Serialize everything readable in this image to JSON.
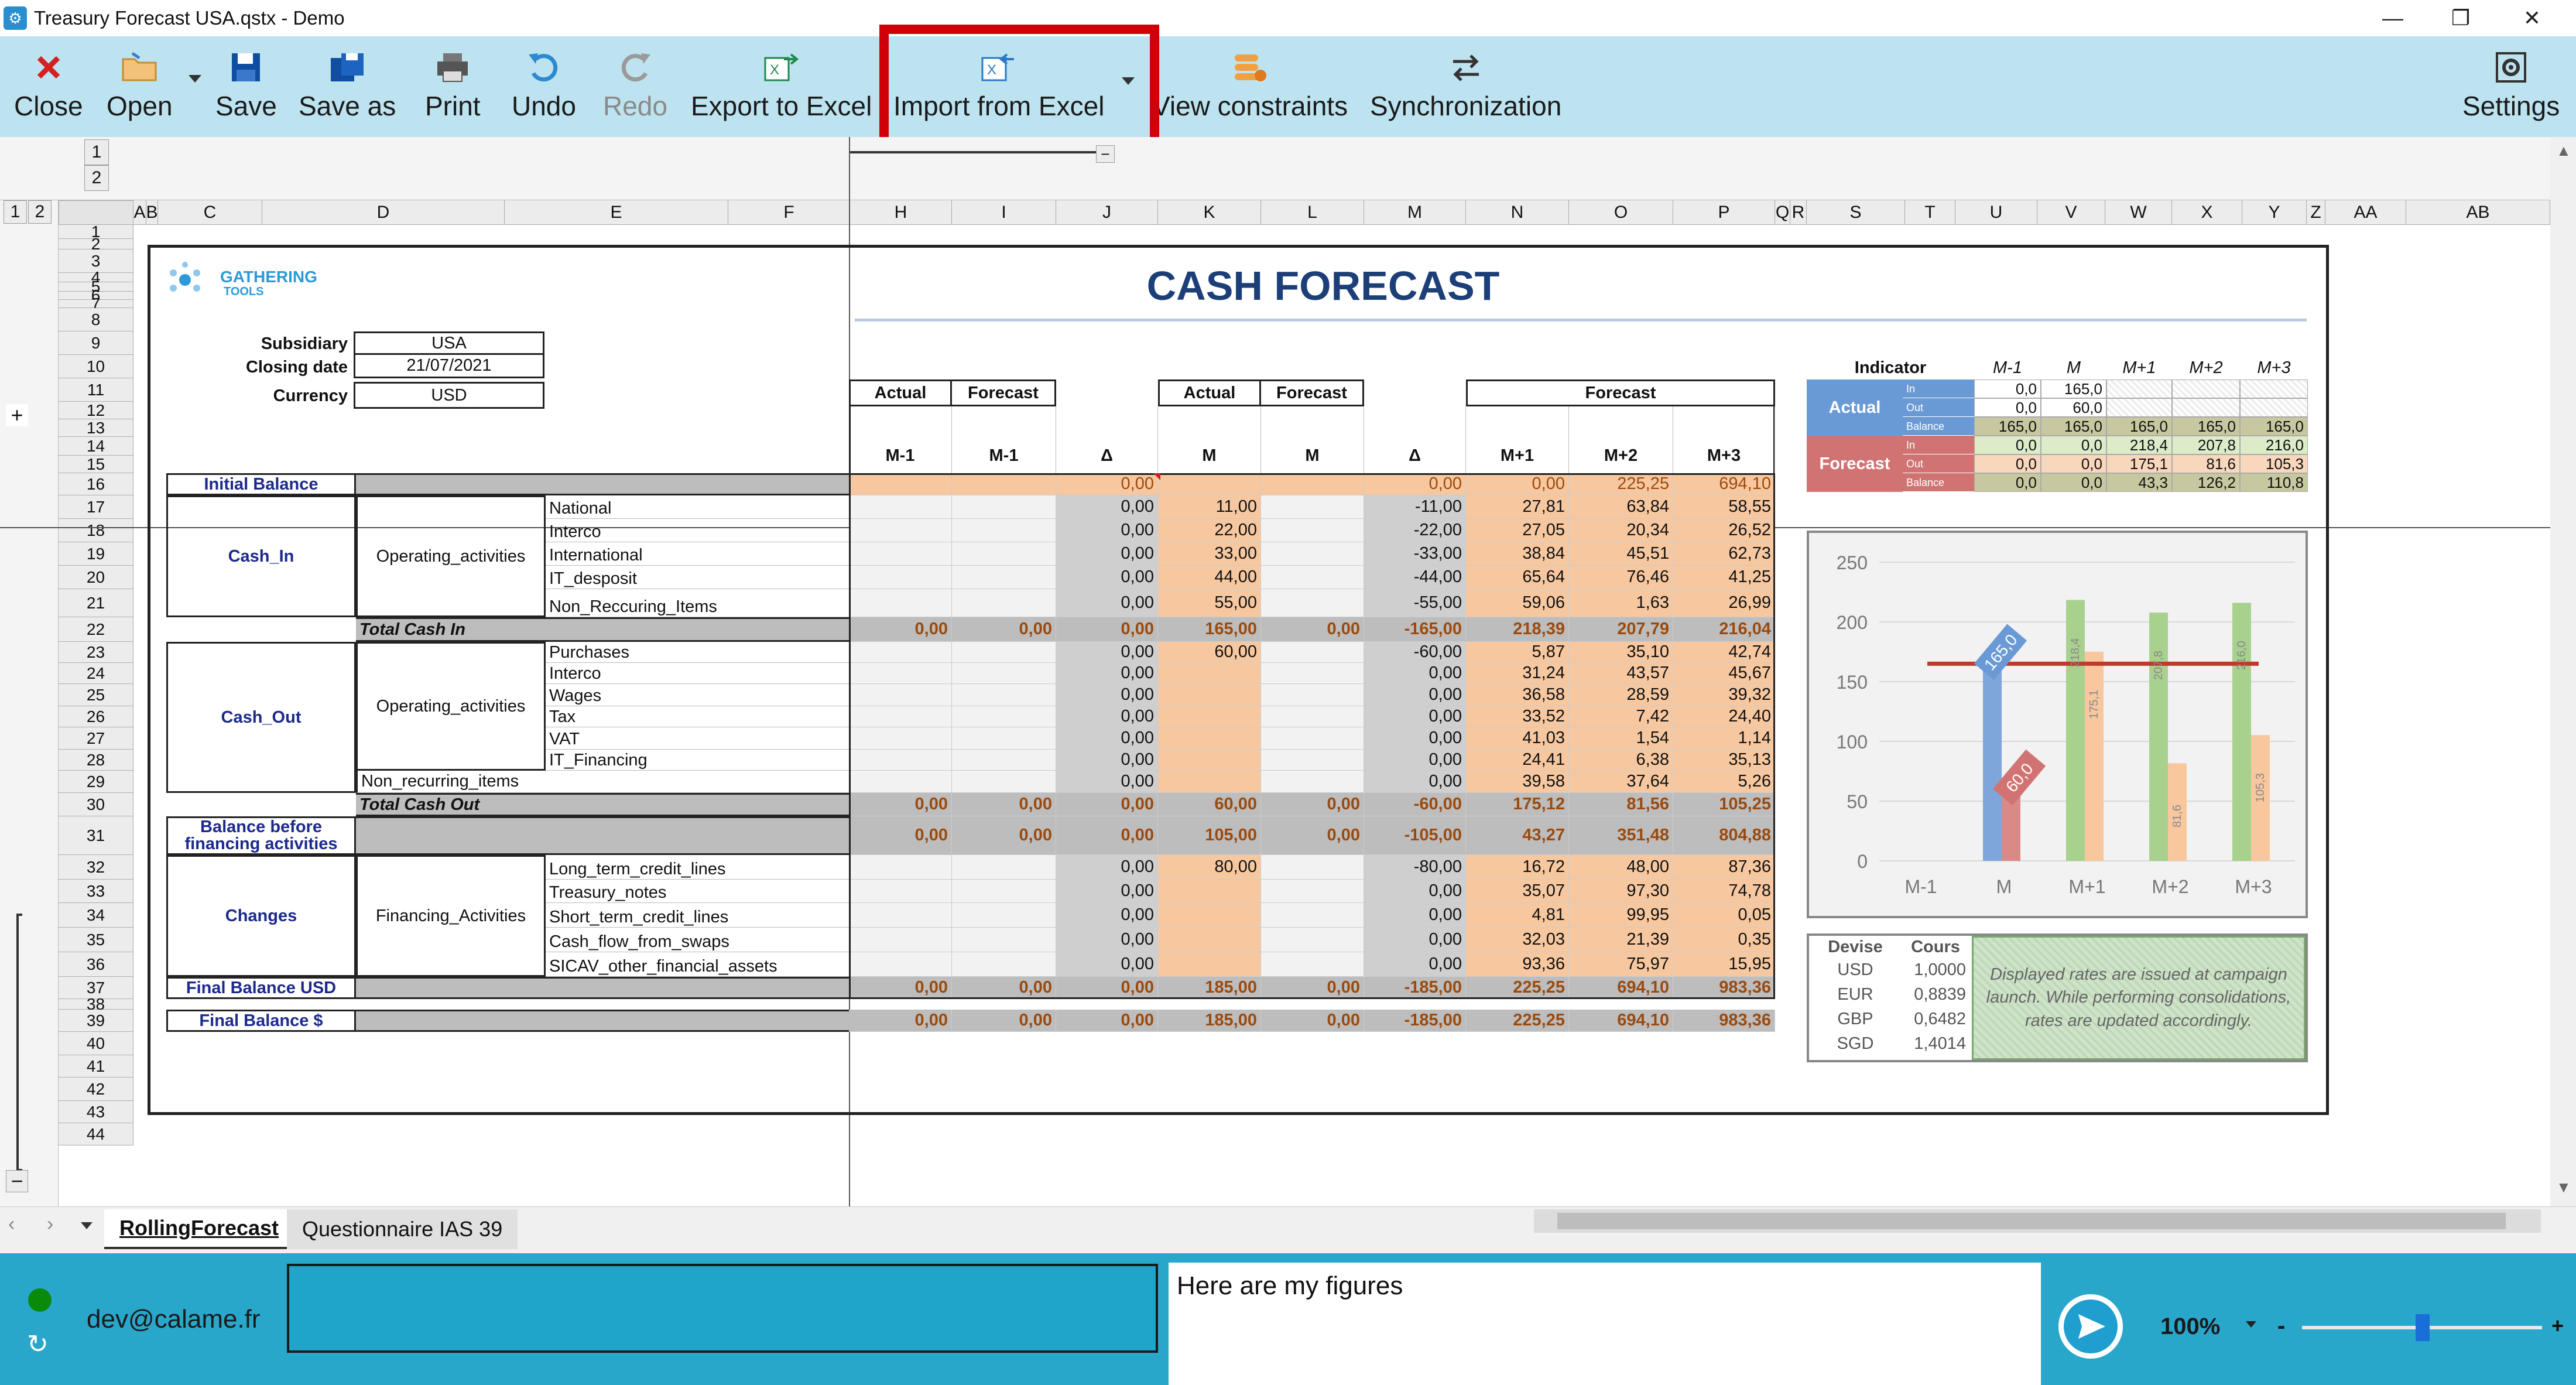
{
  "window": {
    "title": "Treasury Forecast USA.qstx - Demo",
    "min": "—",
    "max": "❐",
    "close": "✕"
  },
  "toolbar": {
    "close": "Close",
    "open": "Open",
    "save": "Save",
    "save_as": "Save as",
    "print": "Print",
    "undo": "Undo",
    "redo": "Redo",
    "export": "Export to Excel",
    "import": "Import from Excel",
    "constraints": "View constraints",
    "sync": "Synchronization",
    "settings": "Settings"
  },
  "grid": {
    "outline_levels": [
      "1",
      "2"
    ],
    "row_outline_levels": [
      "1",
      "2"
    ],
    "columns": [
      "A",
      "B",
      "C",
      "D",
      "E",
      "F",
      "H",
      "I",
      "J",
      "K",
      "L",
      "M",
      "N",
      "O",
      "P",
      "Q",
      "R",
      "S",
      "T",
      "U",
      "V",
      "W",
      "X",
      "Y",
      "Z",
      "AA",
      "AB"
    ],
    "rows": [
      "1",
      "2",
      "3",
      "4",
      "5",
      "6",
      "7",
      "8",
      "9",
      "10",
      "11",
      "12",
      "13",
      "14",
      "15",
      "16",
      "17",
      "18",
      "19",
      "20",
      "21",
      "22",
      "23",
      "24",
      "25",
      "26",
      "27",
      "28",
      "29",
      "30",
      "31",
      "32",
      "33",
      "34",
      "35",
      "36",
      "37",
      "38",
      "39",
      "40",
      "41",
      "42",
      "43",
      "44"
    ],
    "plus": "+",
    "minus": "−"
  },
  "sheet": {
    "logo_line1": "GATHERING",
    "logo_line2": "TOOLS",
    "title": "CASH FORECAST",
    "subsidiary_label": "Subsidiary",
    "subsidiary": "USA",
    "closing_label": "Closing date",
    "closing": "21/07/2021",
    "currency_label": "Currency",
    "currency": "USD",
    "hdr_actual": "Actual",
    "hdr_forecast": "Forecast",
    "hdr_forecast3": "Forecast",
    "col_m_1a": "M-1",
    "col_m_1f": "M-1",
    "col_d": "Δ",
    "col_ma": "M",
    "col_mf": "M",
    "col_d2": "Δ",
    "col_p1": "M+1",
    "col_p2": "M+2",
    "col_p3": "M+3",
    "initial_balance": "Initial Balance",
    "cash_in": "Cash_In",
    "operating": "Operating_activities",
    "cash_out": "Cash_Out",
    "operating2": "Operating_activities",
    "nonrec": "Non_recurring_items",
    "total_in": "Total Cash In",
    "total_out": "Total Cash Out",
    "balance_before": "Balance before financing activities",
    "changes": "Changes",
    "financing": "Financing_Activities",
    "final_usd": "Final Balance USD",
    "final_s": "Final Balance $",
    "rows": [
      {
        "label": "National",
        "v": [
          "",
          "",
          "0,00",
          "11,00",
          "",
          "-11,00",
          "27,81",
          "63,84",
          "58,55"
        ]
      },
      {
        "label": "Interco",
        "v": [
          "",
          "",
          "0,00",
          "22,00",
          "",
          "-22,00",
          "27,05",
          "20,34",
          "26,52"
        ]
      },
      {
        "label": "International",
        "v": [
          "",
          "",
          "0,00",
          "33,00",
          "",
          "-33,00",
          "38,84",
          "45,51",
          "62,73"
        ]
      },
      {
        "label": "IT_desposit",
        "v": [
          "",
          "",
          "0,00",
          "44,00",
          "",
          "-44,00",
          "65,64",
          "76,46",
          "41,25"
        ]
      },
      {
        "label": "Non_Reccuring_Items",
        "v": [
          "",
          "",
          "0,00",
          "55,00",
          "",
          "-55,00",
          "59,06",
          "1,63",
          "26,99"
        ]
      },
      {
        "label": "Purchases",
        "v": [
          "",
          "",
          "0,00",
          "60,00",
          "",
          "-60,00",
          "5,87",
          "35,10",
          "42,74"
        ]
      },
      {
        "label": "Interco",
        "v": [
          "",
          "",
          "0,00",
          "",
          "",
          "0,00",
          "31,24",
          "43,57",
          "45,67"
        ]
      },
      {
        "label": "Wages",
        "v": [
          "",
          "",
          "0,00",
          "",
          "",
          "0,00",
          "36,58",
          "28,59",
          "39,32"
        ]
      },
      {
        "label": "Tax",
        "v": [
          "",
          "",
          "0,00",
          "",
          "",
          "0,00",
          "33,52",
          "7,42",
          "24,40"
        ]
      },
      {
        "label": "VAT",
        "v": [
          "",
          "",
          "0,00",
          "",
          "",
          "0,00",
          "41,03",
          "1,54",
          "1,14"
        ]
      },
      {
        "label": "IT_Financing",
        "v": [
          "",
          "",
          "0,00",
          "",
          "",
          "0,00",
          "24,41",
          "6,38",
          "35,13"
        ]
      },
      {
        "label": "",
        "v": [
          "",
          "",
          "0,00",
          "",
          "",
          "0,00",
          "39,58",
          "37,64",
          "5,26"
        ]
      },
      {
        "label": "Long_term_credit_lines",
        "v": [
          "",
          "",
          "0,00",
          "80,00",
          "",
          "-80,00",
          "16,72",
          "48,00",
          "87,36"
        ]
      },
      {
        "label": "Treasury_notes",
        "v": [
          "",
          "",
          "0,00",
          "",
          "",
          "0,00",
          "35,07",
          "97,30",
          "74,78"
        ]
      },
      {
        "label": "Short_term_credit_lines",
        "v": [
          "",
          "",
          "0,00",
          "",
          "",
          "0,00",
          "4,81",
          "99,95",
          "0,05"
        ]
      },
      {
        "label": "Cash_flow_from_swaps",
        "v": [
          "",
          "",
          "0,00",
          "",
          "",
          "0,00",
          "32,03",
          "21,39",
          "0,35"
        ]
      },
      {
        "label": "SICAV_other_financial_assets",
        "v": [
          "",
          "",
          "0,00",
          "",
          "",
          "0,00",
          "93,36",
          "75,97",
          "15,95"
        ]
      }
    ],
    "initial_vals": [
      "",
      "",
      "0,00",
      "",
      "",
      "0,00",
      "0,00",
      "225,25",
      "694,10"
    ],
    "total_in_vals": [
      "0,00",
      "0,00",
      "0,00",
      "165,00",
      "0,00",
      "-165,00",
      "218,39",
      "207,79",
      "216,04"
    ],
    "total_out_vals": [
      "0,00",
      "0,00",
      "0,00",
      "60,00",
      "0,00",
      "-60,00",
      "175,12",
      "81,56",
      "105,25"
    ],
    "bbf_vals": [
      "0,00",
      "0,00",
      "0,00",
      "105,00",
      "0,00",
      "-105,00",
      "43,27",
      "351,48",
      "804,88"
    ],
    "final_usd_vals": [
      "0,00",
      "0,00",
      "0,00",
      "185,00",
      "0,00",
      "-185,00",
      "225,25",
      "694,10",
      "983,36"
    ],
    "final_s_vals": [
      "0,00",
      "0,00",
      "0,00",
      "185,00",
      "0,00",
      "-185,00",
      "225,25",
      "694,10",
      "983,36"
    ],
    "indicator": {
      "title": "Indicator",
      "cols": [
        "M-1",
        "M",
        "M+1",
        "M+2",
        "M+3"
      ],
      "actual": "Actual",
      "forecast": "Forecast",
      "sub": [
        "In",
        "Out",
        "Balance"
      ],
      "actual_rows": [
        [
          "0,0",
          "165,0",
          "",
          "",
          ""
        ],
        [
          "0,0",
          "60,0",
          "",
          "",
          ""
        ],
        [
          "165,0",
          "165,0",
          "165,0",
          "165,0",
          "165,0"
        ]
      ],
      "forecast_rows": [
        [
          "0,0",
          "0,0",
          "218,4",
          "207,8",
          "216,0"
        ],
        [
          "0,0",
          "0,0",
          "175,1",
          "81,6",
          "105,3"
        ],
        [
          "0,0",
          "0,0",
          "43,3",
          "126,2",
          "110,8"
        ]
      ]
    },
    "rates": {
      "h1": "Devise",
      "h2": "Cours",
      "rows": [
        [
          "USD",
          "1,0000"
        ],
        [
          "EUR",
          "0,8839"
        ],
        [
          "GBP",
          "0,6482"
        ],
        [
          "SGD",
          "1,4014"
        ]
      ],
      "note": "Displayed rates are issued at campaign launch. While performing consolidations, rates are updated accordingly."
    }
  },
  "chart_data": {
    "type": "bar",
    "categories": [
      "M-1",
      "M",
      "M+1",
      "M+2",
      "M+3"
    ],
    "series": [
      {
        "values": [
          0,
          165,
          0,
          0,
          0
        ],
        "color": "#7ea6db"
      },
      {
        "values": [
          0,
          60,
          0,
          0,
          0
        ],
        "color": "#d98a86"
      },
      {
        "values": [
          0,
          0,
          218.4,
          207.8,
          216.0
        ],
        "color": "#a9d18e"
      },
      {
        "values": [
          0,
          0,
          175.1,
          81.6,
          105.3
        ],
        "color": "#f8c79e"
      }
    ],
    "data_labels": [
      {
        "category": "M",
        "text": "165,0"
      },
      {
        "category": "M",
        "text": "60,0"
      },
      {
        "category": "M+1",
        "text": "218,4"
      },
      {
        "category": "M+1",
        "text": "175,1"
      },
      {
        "category": "M+2",
        "text": "207,8"
      },
      {
        "category": "M+2",
        "text": "81,6"
      },
      {
        "category": "M+3",
        "text": "216,0"
      },
      {
        "category": "M+3",
        "text": "105,3"
      }
    ],
    "reference_line": 165,
    "yticks": [
      "0",
      "50",
      "100",
      "150",
      "200",
      "250"
    ],
    "ylim": [
      0,
      250
    ]
  },
  "tabs": {
    "active": "RollingForecast",
    "other": "Questionnaire IAS 39"
  },
  "bottom": {
    "user": "dev@calame.fr",
    "message": "Here are my figures",
    "zoom": "100%",
    "minus": "-",
    "plus": "+"
  }
}
